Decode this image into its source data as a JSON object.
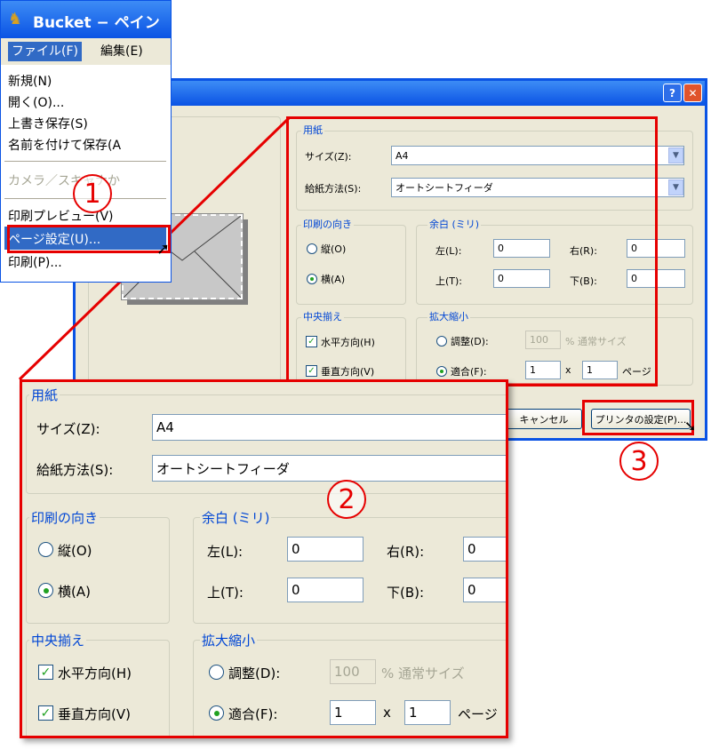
{
  "app": {
    "title": "Bucket − ペイン"
  },
  "menubar": {
    "file": "ファイル(F)",
    "edit": "編集(E)"
  },
  "file_menu": {
    "items": [
      "新規(N)",
      "開く(O)...",
      "上書き保存(S)",
      "名前を付けて保存(A",
      "カメラ／スキャナか",
      "印刷プレビュー(V)",
      "ページ設定(U)...",
      "印刷(P)..."
    ]
  },
  "dialog": {
    "help_glyph": "?",
    "close_glyph": "✕",
    "paper": {
      "title": "用紙",
      "size_label": "サイズ(Z):",
      "size_value": "A4",
      "source_label": "給紙方法(S):",
      "source_value": "オートシートフィーダ"
    },
    "orientation": {
      "title": "印刷の向き",
      "portrait": "縦(O)",
      "landscape": "横(A)"
    },
    "margins": {
      "title": "余白 (ミリ)",
      "left_label": "左(L):",
      "left_value": "0",
      "right_label": "右(R):",
      "right_value": "0",
      "top_label": "上(T):",
      "top_value": "0",
      "bottom_label": "下(B):",
      "bottom_value": "0"
    },
    "centering": {
      "title": "中央揃え",
      "horizontal": "水平方向(H)",
      "vertical": "垂直方向(V)"
    },
    "scaling": {
      "title": "拡大縮小",
      "adjust_label": "調整(D):",
      "adjust_value": "100",
      "adjust_suffix": "% 通常サイズ",
      "fit_label": "適合(F):",
      "fit_x": "1",
      "x_sep": "x",
      "fit_y": "1",
      "pages_suffix": "ページ"
    },
    "buttons": {
      "cancel": "キャンセル",
      "printer_setup": "プリンタの設定(P)..."
    }
  },
  "callouts": {
    "one": "1",
    "two": "2",
    "three": "3"
  },
  "colors": {
    "highlight": "#e60000",
    "group_title": "#0046d5",
    "dialog_bg": "#ece9d8",
    "titlebar": "#0a53e4"
  }
}
